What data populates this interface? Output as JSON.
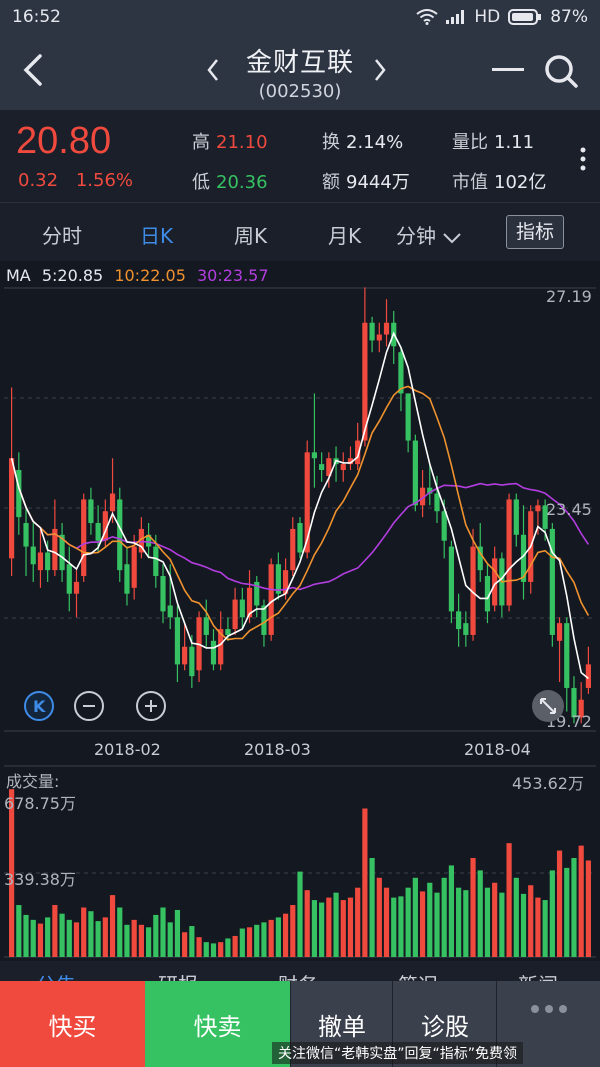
{
  "status": {
    "time": "16:52",
    "network": "HD",
    "battery": "87%"
  },
  "header": {
    "title": "金财互联",
    "code": "(002530)"
  },
  "quote": {
    "price": "20.80",
    "change": "0.32",
    "change_pct": "1.56%",
    "high_label": "高",
    "high": "21.10",
    "low_label": "低",
    "low": "20.36",
    "turnover_label": "换",
    "turnover": "2.14%",
    "amount_label": "额",
    "amount": "9444万",
    "vol_ratio_label": "量比",
    "vol_ratio": "1.11",
    "mktcap_label": "市值",
    "mktcap": "102亿"
  },
  "tabs": [
    "分时",
    "日K",
    "周K",
    "月K",
    "分钟"
  ],
  "active_tab": "日K",
  "indicator_button": "指标",
  "ma": {
    "ma_label": "MA",
    "ma5": "5:20.85",
    "ma10": "10:22.05",
    "ma30": "30:23.57",
    "colors": {
      "ma5": "#ffffff",
      "ma10": "#f0922e",
      "ma30": "#b33ee0"
    }
  },
  "price_axis": {
    "top": "27.19",
    "mid": "23.45",
    "bottom": "19.72"
  },
  "date_axis": [
    "2018-02",
    "2018-03",
    "2018-04"
  ],
  "volume": {
    "label": "成交量:",
    "max_label": "678.75万",
    "half_label": "339.38万",
    "latest": "453.62万"
  },
  "bottom_tabs": [
    "公告",
    "研报",
    "财务",
    "简况",
    "新闻"
  ],
  "actions": {
    "buy": "快买",
    "sell": "快卖",
    "cancel": "撤单",
    "diagnose": "诊股"
  },
  "watermark": "关注微信“老韩实盘”回复“指标”免费领",
  "colors": {
    "up": "#f04a3e",
    "down": "#36c262",
    "accent": "#3f8ce8",
    "buy_bg": "#f04a3e",
    "sell_bg": "#36c262"
  },
  "chart_data": {
    "type": "candlestick",
    "candles": [
      [
        22.6,
        24.3,
        25.5,
        22.3
      ],
      [
        24.1,
        23.3,
        24.4,
        23.0
      ],
      [
        23.2,
        22.8,
        23.5,
        22.3
      ],
      [
        22.8,
        22.5,
        23.2,
        22.2
      ],
      [
        22.4,
        22.7,
        23.1,
        22.1
      ],
      [
        22.7,
        22.4,
        22.9,
        22.2
      ],
      [
        22.4,
        23.1,
        23.6,
        22.3
      ],
      [
        23.0,
        22.4,
        23.2,
        22.2
      ],
      [
        22.5,
        22.0,
        22.8,
        21.7
      ],
      [
        22.0,
        22.2,
        22.4,
        21.6
      ],
      [
        22.3,
        23.6,
        23.7,
        22.2
      ],
      [
        23.6,
        23.2,
        23.8,
        23.0
      ],
      [
        23.2,
        22.9,
        23.5,
        22.7
      ],
      [
        22.9,
        23.4,
        23.6,
        22.8
      ],
      [
        23.4,
        23.7,
        24.3,
        23.2
      ],
      [
        23.6,
        22.4,
        23.8,
        22.2
      ],
      [
        22.5,
        22.0,
        22.8,
        21.8
      ],
      [
        22.1,
        22.8,
        23.0,
        21.9
      ],
      [
        22.7,
        23.1,
        23.3,
        22.6
      ],
      [
        23.0,
        22.8,
        23.2,
        22.6
      ],
      [
        22.8,
        22.3,
        23.0,
        22.1
      ],
      [
        22.3,
        21.7,
        22.5,
        21.5
      ],
      [
        21.8,
        21.6,
        22.5,
        21.4
      ],
      [
        21.6,
        20.8,
        21.8,
        20.5
      ],
      [
        20.8,
        21.1,
        21.5,
        20.7
      ],
      [
        21.1,
        20.6,
        21.3,
        20.4
      ],
      [
        20.7,
        21.6,
        21.7,
        20.5
      ],
      [
        21.6,
        21.3,
        21.9,
        21.1
      ],
      [
        21.2,
        20.8,
        21.4,
        20.7
      ],
      [
        20.8,
        21.4,
        21.7,
        20.7
      ],
      [
        21.4,
        21.3,
        21.6,
        21.2
      ],
      [
        21.4,
        21.9,
        22.1,
        21.3
      ],
      [
        21.9,
        21.6,
        22.1,
        21.4
      ],
      [
        21.6,
        22.1,
        22.4,
        21.5
      ],
      [
        22.2,
        21.8,
        22.3,
        21.6
      ],
      [
        21.8,
        21.3,
        21.9,
        21.1
      ],
      [
        21.3,
        22.5,
        22.6,
        21.2
      ],
      [
        22.5,
        22.0,
        22.7,
        21.9
      ],
      [
        22.0,
        22.4,
        22.6,
        21.9
      ],
      [
        22.4,
        23.1,
        23.3,
        22.3
      ],
      [
        23.2,
        22.7,
        23.3,
        22.6
      ],
      [
        22.7,
        24.4,
        24.6,
        22.6
      ],
      [
        24.4,
        24.3,
        25.4,
        23.8
      ],
      [
        24.2,
        24.1,
        24.4,
        23.9
      ],
      [
        24.0,
        24.3,
        24.4,
        23.8
      ],
      [
        24.3,
        24.2,
        24.5,
        23.9
      ],
      [
        24.1,
        24.2,
        24.4,
        23.9
      ],
      [
        24.2,
        24.3,
        24.5,
        24.1
      ],
      [
        24.2,
        24.6,
        24.9,
        24.1
      ],
      [
        24.6,
        26.6,
        27.2,
        24.5
      ],
      [
        26.6,
        26.3,
        26.7,
        26.1
      ],
      [
        26.3,
        26.4,
        26.6,
        26.1
      ],
      [
        26.4,
        26.6,
        27.0,
        26.2
      ],
      [
        26.6,
        26.2,
        26.8,
        25.9
      ],
      [
        26.1,
        25.4,
        26.2,
        25.1
      ],
      [
        25.4,
        24.6,
        25.4,
        24.4
      ],
      [
        24.6,
        23.5,
        24.7,
        23.4
      ],
      [
        23.5,
        23.8,
        24.1,
        23.3
      ],
      [
        23.8,
        23.7,
        24.2,
        23.5
      ],
      [
        23.7,
        23.4,
        24.0,
        23.2
      ],
      [
        23.4,
        22.9,
        23.6,
        22.6
      ],
      [
        22.8,
        21.7,
        22.9,
        21.5
      ],
      [
        21.7,
        21.4,
        22.0,
        21.1
      ],
      [
        21.5,
        21.3,
        21.7,
        21.1
      ],
      [
        21.3,
        22.8,
        23.1,
        21.2
      ],
      [
        22.8,
        22.4,
        23.2,
        22.2
      ],
      [
        22.3,
        21.7,
        22.5,
        21.5
      ],
      [
        21.8,
        22.6,
        22.8,
        21.7
      ],
      [
        22.6,
        21.8,
        22.7,
        21.6
      ],
      [
        21.8,
        23.6,
        23.7,
        21.7
      ],
      [
        23.6,
        23.0,
        23.7,
        22.8
      ],
      [
        23.0,
        22.2,
        23.5,
        21.9
      ],
      [
        22.2,
        23.4,
        23.5,
        22.0
      ],
      [
        23.4,
        23.5,
        23.6,
        23.0
      ],
      [
        23.5,
        23.1,
        23.6,
        22.9
      ],
      [
        23.1,
        21.3,
        23.2,
        21.1
      ],
      [
        21.2,
        21.5,
        21.6,
        20.5
      ],
      [
        21.5,
        20.4,
        21.6,
        20.0
      ],
      [
        20.4,
        19.9,
        20.6,
        19.8
      ],
      [
        19.9,
        20.2,
        20.5,
        19.8
      ],
      [
        20.4,
        20.8,
        21.1,
        20.3
      ]
    ],
    "ma5": [],
    "ma10": [],
    "ma30": [],
    "volume": [
      678,
      210,
      170,
      150,
      135,
      160,
      210,
      175,
      150,
      140,
      200,
      185,
      145,
      160,
      250,
      200,
      130,
      150,
      130,
      120,
      170,
      200,
      140,
      190,
      100,
      125,
      80,
      60,
      55,
      60,
      75,
      85,
      115,
      120,
      130,
      140,
      150,
      160,
      175,
      210,
      345,
      270,
      230,
      220,
      240,
      260,
      230,
      240,
      280,
      600,
      400,
      320,
      280,
      240,
      245,
      280,
      320,
      265,
      300,
      260,
      320,
      370,
      280,
      270,
      400,
      350,
      280,
      300,
      260,
      460,
      320,
      255,
      290,
      240,
      230,
      350,
      430,
      360,
      400,
      450,
      390
    ],
    "ylim": [
      19.72,
      27.19
    ]
  }
}
